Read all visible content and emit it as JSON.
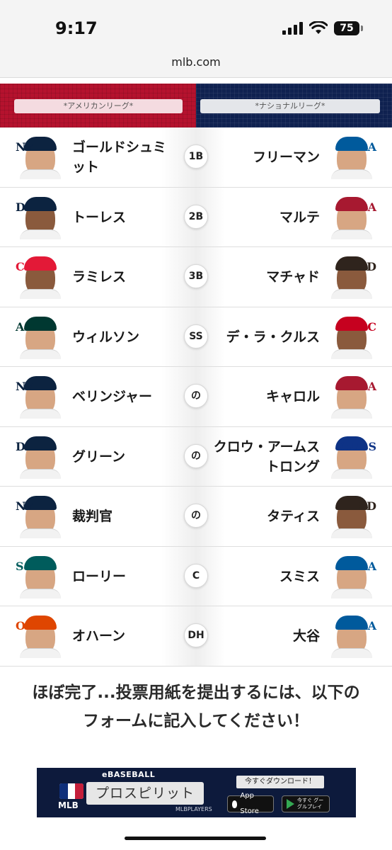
{
  "status_bar": {
    "time": "9:17",
    "battery": "75"
  },
  "browser": {
    "url": "mlb.com"
  },
  "leagues": {
    "al": "*アメリカンリーグ*",
    "nl": "*ナショナルリーグ*"
  },
  "rows": [
    {
      "position": "1B",
      "al": {
        "name": "ゴールドシュミット",
        "team_logo": "NY",
        "logo_color": "#0c2340"
      },
      "nl": {
        "name": "フリーマン",
        "team_logo": "LA",
        "logo_color": "#005a9c"
      }
    },
    {
      "position": "2B",
      "al": {
        "name": "トーレス",
        "team_logo": "D",
        "logo_color": "#0c2340"
      },
      "nl": {
        "name": "マルテ",
        "team_logo": "A",
        "logo_color": "#a71930"
      }
    },
    {
      "position": "3B",
      "al": {
        "name": "ラミレス",
        "team_logo": "C",
        "logo_color": "#e31937"
      },
      "nl": {
        "name": "マチャド",
        "team_logo": "SD",
        "logo_color": "#2f241d"
      }
    },
    {
      "position": "SS",
      "al": {
        "name": "ウィルソン",
        "team_logo": "A's",
        "logo_color": "#003831"
      },
      "nl": {
        "name": "デ・ラ・クルス",
        "team_logo": "C",
        "logo_color": "#c6011f"
      }
    },
    {
      "position": "の",
      "al": {
        "name": "ベリンジャー",
        "team_logo": "NY",
        "logo_color": "#0c2340"
      },
      "nl": {
        "name": "キャロル",
        "team_logo": "A",
        "logo_color": "#a71930"
      }
    },
    {
      "position": "の",
      "al": {
        "name": "グリーン",
        "team_logo": "D",
        "logo_color": "#0c2340"
      },
      "nl": {
        "name": "クロウ・アームストロング",
        "team_logo": "CUBS",
        "logo_color": "#0e3386"
      }
    },
    {
      "position": "の",
      "al": {
        "name": "裁判官",
        "team_logo": "NY",
        "logo_color": "#0c2340"
      },
      "nl": {
        "name": "タティス",
        "team_logo": "SD",
        "logo_color": "#2f241d"
      }
    },
    {
      "position": "C",
      "al": {
        "name": "ローリー",
        "team_logo": "S",
        "logo_color": "#005c5c"
      },
      "nl": {
        "name": "スミス",
        "team_logo": "LA",
        "logo_color": "#005a9c"
      }
    },
    {
      "position": "DH",
      "al": {
        "name": "オハーン",
        "team_logo": "O",
        "logo_color": "#df4601"
      },
      "nl": {
        "name": "大谷",
        "team_logo": "LA",
        "logo_color": "#005a9c"
      }
    }
  ],
  "notice": {
    "line1": "ほぼ完了...投票用紙を提出するには、以下の",
    "line2": "フォームに記入してください！"
  },
  "ad": {
    "brand": "eBASEBALL",
    "mlb": "MLB",
    "title": "プロスピリット",
    "players": "MLBPLAYERS",
    "download": "今すぐダウンロード！",
    "app_store": "App Store",
    "google_play": "今すぐ グーグルプレイ"
  }
}
